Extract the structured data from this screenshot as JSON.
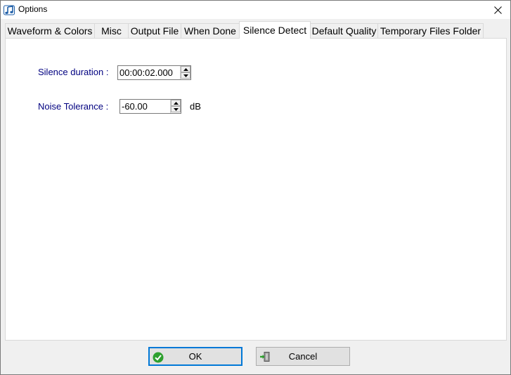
{
  "window": {
    "title": "Options"
  },
  "tabs": [
    {
      "label": "Waveform & Colors"
    },
    {
      "label": "Misc"
    },
    {
      "label": "Output File"
    },
    {
      "label": "When Done"
    },
    {
      "label": "Silence Detect",
      "active": true
    },
    {
      "label": "Default Quality"
    },
    {
      "label": "Temporary Files Folder"
    }
  ],
  "silence": {
    "duration_label": "Silence duration :",
    "duration_value": "00:00:02.000",
    "tolerance_label": "Noise Tolerance :",
    "tolerance_value": "-60.00",
    "tolerance_unit": "dB"
  },
  "buttons": {
    "ok": "OK",
    "cancel": "Cancel"
  },
  "colors": {
    "label": "#000080",
    "accent": "#0078d7",
    "ok_icon": "#2ea02e"
  },
  "icons": [
    "music-note-icon",
    "close-icon",
    "spin-up-icon",
    "spin-down-icon",
    "checkmark-icon",
    "exit-door-icon"
  ]
}
